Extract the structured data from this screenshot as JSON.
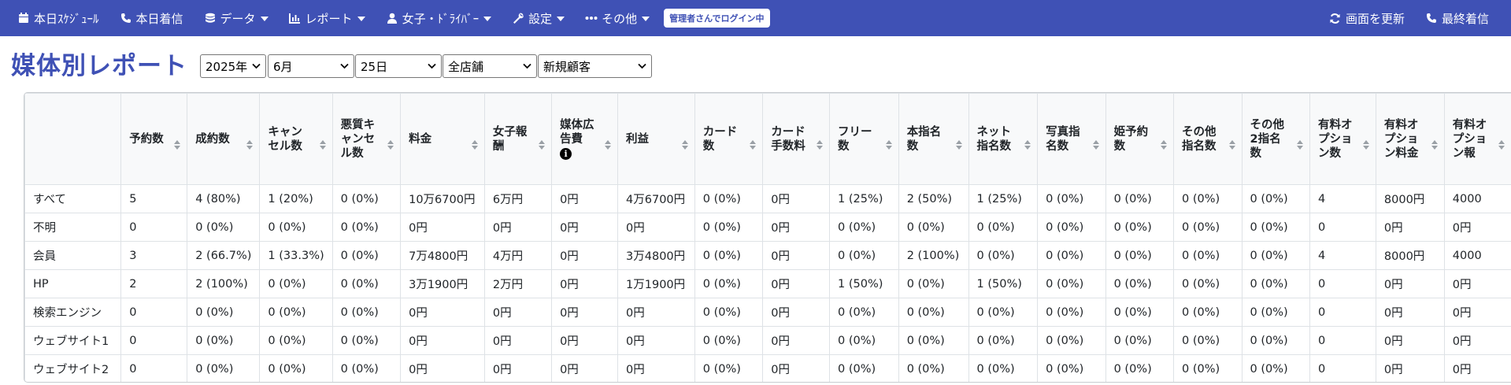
{
  "nav": {
    "left": [
      {
        "label": "本日ｽｹｼﾞｭｰﾙ",
        "icon": "calendar-icon",
        "caret": false
      },
      {
        "label": "本日着信",
        "icon": "phone-icon",
        "caret": false
      },
      {
        "label": "データ",
        "icon": "database-icon",
        "caret": true
      },
      {
        "label": "レポート",
        "icon": "chart-icon",
        "caret": true
      },
      {
        "label": "女子・ﾄﾞﾗｲﾊﾞｰ",
        "icon": "user-icon",
        "caret": true
      },
      {
        "label": "設定",
        "icon": "wrench-icon",
        "caret": true
      },
      {
        "label": "その他",
        "icon": "ellipsis-icon",
        "caret": true
      }
    ],
    "admin_badge": "管理者さんでログイン中",
    "right": [
      {
        "label": "画面を更新",
        "icon": "refresh-icon"
      },
      {
        "label": "最終着信",
        "icon": "phone-icon"
      }
    ],
    "color": "#3f51b5"
  },
  "page": {
    "title": "媒体別レポート",
    "filters": {
      "year": "2025年",
      "month": "6月",
      "day": "25日",
      "store": "全店舗",
      "customer": "新規顧客"
    }
  },
  "table": {
    "headers": [
      "",
      "予約数",
      "成約数",
      "キャンセル数",
      "悪質キャンセル数",
      "料金",
      "女子報酬",
      "媒体広告費",
      "利益",
      "カード数",
      "カード手数料",
      "フリー数",
      "本指名数",
      "ネット指名数",
      "写真指名数",
      "姫予約数",
      "その他指名数",
      "その他2指名数",
      "有料オプション数",
      "有料オプション料金",
      "有料オプション報"
    ],
    "rows": [
      [
        "すべて",
        "5",
        "4 (80%)",
        "1 (20%)",
        "0 (0%)",
        "10万6700円",
        "6万円",
        "0円",
        "4万6700円",
        "0 (0%)",
        "0円",
        "1 (25%)",
        "2 (50%)",
        "1 (25%)",
        "0 (0%)",
        "0 (0%)",
        "0 (0%)",
        "0 (0%)",
        "4",
        "8000円",
        "4000"
      ],
      [
        "不明",
        "0",
        "0 (0%)",
        "0 (0%)",
        "0 (0%)",
        "0円",
        "0円",
        "0円",
        "0円",
        "0 (0%)",
        "0円",
        "0 (0%)",
        "0 (0%)",
        "0 (0%)",
        "0 (0%)",
        "0 (0%)",
        "0 (0%)",
        "0 (0%)",
        "0",
        "0円",
        "0円"
      ],
      [
        "会員",
        "3",
        "2 (66.7%)",
        "1 (33.3%)",
        "0 (0%)",
        "7万4800円",
        "4万円",
        "0円",
        "3万4800円",
        "0 (0%)",
        "0円",
        "0 (0%)",
        "2 (100%)",
        "0 (0%)",
        "0 (0%)",
        "0 (0%)",
        "0 (0%)",
        "0 (0%)",
        "4",
        "8000円",
        "4000"
      ],
      [
        "HP",
        "2",
        "2 (100%)",
        "0 (0%)",
        "0 (0%)",
        "3万1900円",
        "2万円",
        "0円",
        "1万1900円",
        "0 (0%)",
        "0円",
        "1 (50%)",
        "0 (0%)",
        "1 (50%)",
        "0 (0%)",
        "0 (0%)",
        "0 (0%)",
        "0 (0%)",
        "0",
        "0円",
        "0円"
      ],
      [
        "検索エンジン",
        "0",
        "0 (0%)",
        "0 (0%)",
        "0 (0%)",
        "0円",
        "0円",
        "0円",
        "0円",
        "0 (0%)",
        "0円",
        "0 (0%)",
        "0 (0%)",
        "0 (0%)",
        "0 (0%)",
        "0 (0%)",
        "0 (0%)",
        "0 (0%)",
        "0",
        "0円",
        "0円"
      ],
      [
        "ウェブサイト1",
        "0",
        "0 (0%)",
        "0 (0%)",
        "0 (0%)",
        "0円",
        "0円",
        "0円",
        "0円",
        "0 (0%)",
        "0円",
        "0 (0%)",
        "0 (0%)",
        "0 (0%)",
        "0 (0%)",
        "0 (0%)",
        "0 (0%)",
        "0 (0%)",
        "0",
        "0円",
        "0円"
      ],
      [
        "ウェブサイト2",
        "0",
        "0 (0%)",
        "0 (0%)",
        "0 (0%)",
        "0円",
        "0円",
        "0円",
        "0円",
        "0 (0%)",
        "0円",
        "0 (0%)",
        "0 (0%)",
        "0 (0%)",
        "0 (0%)",
        "0 (0%)",
        "0 (0%)",
        "0 (0%)",
        "0",
        "0円",
        "0円"
      ]
    ]
  }
}
